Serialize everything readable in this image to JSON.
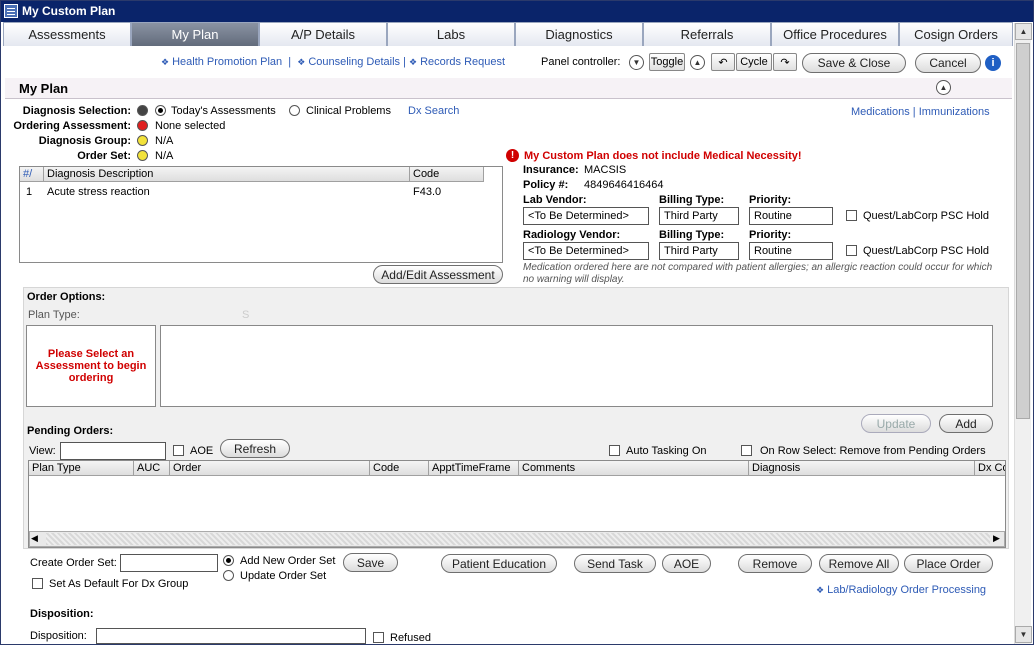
{
  "window": {
    "title": "My Custom Plan"
  },
  "tabs": [
    {
      "label": "Assessments"
    },
    {
      "label": "My Plan"
    },
    {
      "label": "A/P Details"
    },
    {
      "label": "Labs"
    },
    {
      "label": "Diagnostics"
    },
    {
      "label": "Referrals"
    },
    {
      "label": "Office Procedures"
    },
    {
      "label": "Cosign Orders"
    }
  ],
  "toolbar": {
    "links": [
      "Health Promotion Plan",
      "Counseling Details",
      "Records Request"
    ],
    "panel_controller_label": "Panel controller:",
    "toggle_label": "Toggle",
    "cycle_label": "Cycle",
    "save_close_label": "Save & Close",
    "cancel_label": "Cancel"
  },
  "section": {
    "title": "My Plan"
  },
  "diagnosis": {
    "selection_label": "Diagnosis Selection:",
    "option_today": "Today's Assessments",
    "option_problems": "Clinical Problems",
    "dx_search": "Dx Search",
    "ordering_label": "Ordering Assessment:",
    "ordering_value": "None selected",
    "group_label": "Diagnosis Group:",
    "group_value": "N/A",
    "orderset_label": "Order Set:",
    "orderset_value": "N/A"
  },
  "right_links": {
    "medications": "Medications",
    "separator": "|",
    "immunizations": "Immunizations"
  },
  "dx_grid": {
    "headers": [
      "#/",
      "Diagnosis Description",
      "Code"
    ],
    "rows": [
      {
        "num": "1",
        "desc": "Acute stress reaction",
        "code": "F43.0"
      }
    ]
  },
  "add_edit_label": "Add/Edit Assessment",
  "necessity": {
    "warning": "My Custom Plan does not include Medical Necessity!",
    "insurance_label": "Insurance:",
    "insurance_value": "MACSIS",
    "policy_label": "Policy #:",
    "policy_value": "4849646416464"
  },
  "vendors": {
    "lab_vendor_label": "Lab Vendor:",
    "lab_vendor_value": "<To Be Determined>",
    "billing_label": "Billing Type:",
    "billing_value": "Third Party",
    "priority_label": "Priority:",
    "priority_value": "Routine",
    "psc_label": "Quest/LabCorp PSC Hold",
    "rad_vendor_label": "Radiology Vendor:",
    "rad_vendor_value": "<To Be Determined>",
    "rad_billing_value": "Third Party",
    "rad_priority_value": "Routine",
    "note": "Medication ordered here are not compared with patient allergies; an allergic reaction could occur for which no warning will display."
  },
  "order_options": {
    "title": "Order Options:",
    "plan_type_label": "Plan Type:",
    "plan_type_value": "S",
    "prompt": "Please Select an Assessment to begin ordering",
    "update_label": "Update",
    "add_label": "Add"
  },
  "pending": {
    "title": "Pending Orders:",
    "view_label": "View:",
    "aoe_label": "AOE",
    "refresh_label": "Refresh",
    "auto_tasking_label": "Auto Tasking On",
    "on_row_label": "On Row Select: Remove from Pending Orders",
    "columns": [
      "Plan Type",
      "AUC",
      "Order",
      "Code",
      "ApptTimeFrame",
      "Comments",
      "Diagnosis",
      "Dx Co"
    ]
  },
  "bottom": {
    "create_set_label": "Create Order Set:",
    "add_new_label": "Add New Order Set",
    "update_set_label": "Update Order Set",
    "save_label": "Save",
    "default_label": "Set As Default For Dx Group",
    "patient_ed_label": "Patient Education",
    "send_task_label": "Send Task",
    "aoe_label": "AOE",
    "remove_label": "Remove",
    "remove_all_label": "Remove All",
    "place_order_label": "Place Order",
    "lab_link": "Lab/Radiology Order Processing"
  },
  "disposition": {
    "title": "Disposition:",
    "label": "Disposition:",
    "refused_label": "Refused"
  }
}
